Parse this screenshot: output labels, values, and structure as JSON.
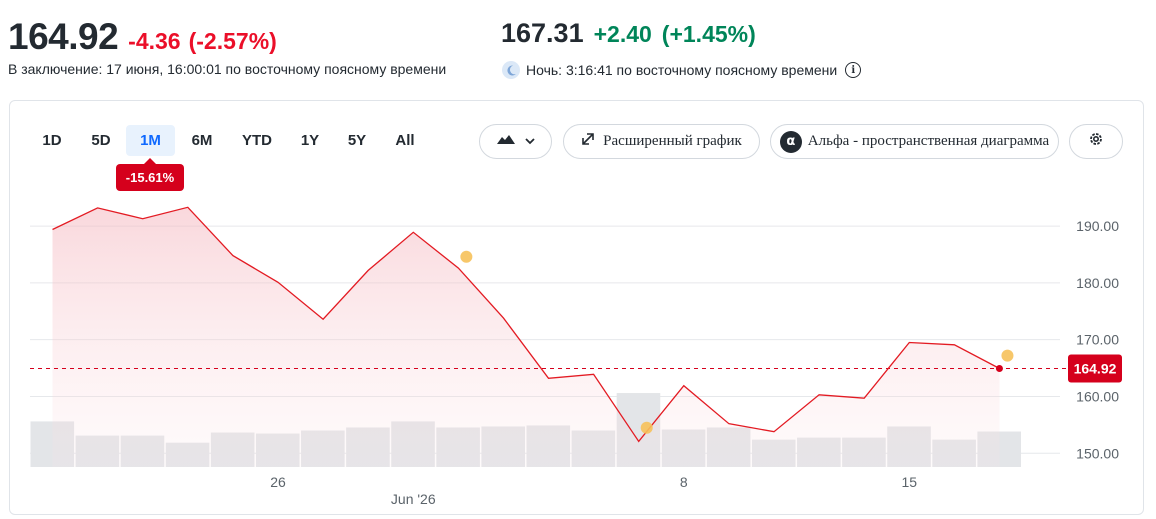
{
  "quote": {
    "price": "164.92",
    "change": "-4.36",
    "change_pct": "(-2.57%)",
    "close_note": "В заключение: 17 июня, 16:00:01 по восточному поясному времени"
  },
  "after_hours": {
    "price": "167.31",
    "change": "+2.40",
    "change_pct": "(+1.45%)",
    "note": "Ночь: 3:16:41 по восточному поясному времени"
  },
  "ranges": [
    "1D",
    "5D",
    "1M",
    "6M",
    "YTD",
    "1Y",
    "5Y",
    "All"
  ],
  "active_range": "1M",
  "range_change_badge": "-15.61%",
  "toolbar": {
    "chart_type_icon": "mountain-chart-icon",
    "advanced_chart_label": "Расширенный график",
    "alpha_label": "Альфа - пространственная диаграмма",
    "alpha_glyph": "α",
    "settings_icon": "gear-icon"
  },
  "colors": {
    "negative": "#eb0f29",
    "positive": "#008559",
    "line": "#e31b23",
    "fill": "#f8d4d8",
    "volume": "#e3e5e8",
    "event_dot": "#f6c15a",
    "active_range": "#0f69ff"
  },
  "chart_data": {
    "type": "area",
    "title": "",
    "xlabel": "",
    "ylabel": "",
    "ylim": [
      146,
      196
    ],
    "yticks": [
      150,
      160,
      170,
      180,
      190
    ],
    "ytick_labels": [
      "150.00",
      "160.00",
      "170.00",
      "180.00",
      "190.00"
    ],
    "xtick_labels": [
      "26",
      "8",
      "15"
    ],
    "month_label": "Jun '26",
    "grid": true,
    "series": [
      {
        "values": [
          189.4,
          193.2,
          191.3,
          193.3,
          184.8,
          180.1,
          173.6,
          182.2,
          188.9,
          182.6,
          173.8,
          163.2,
          163.9,
          152.1,
          161.9,
          155.2,
          153.8,
          160.3,
          159.7,
          169.5,
          169.1,
          164.92
        ]
      }
    ],
    "volume": [
      45,
      31,
      31,
      24,
      34,
      33,
      36,
      39,
      45,
      39,
      40,
      41,
      36,
      73,
      37,
      39,
      27,
      29,
      29,
      40,
      27,
      35
    ],
    "last_price_label": "164.92",
    "event_markers": [
      {
        "index": 9,
        "value": 184.6
      },
      {
        "index": 13,
        "value": 154.5
      },
      {
        "index": 21,
        "value": 167.2
      }
    ]
  }
}
